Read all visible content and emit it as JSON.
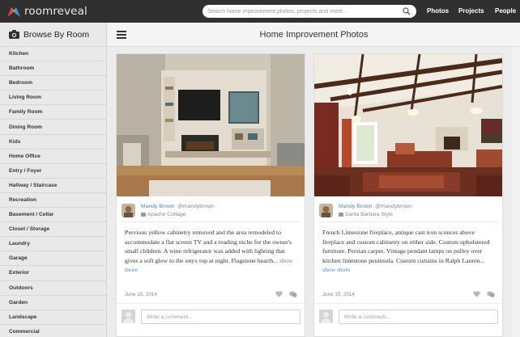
{
  "brand": {
    "name": "roomreveal"
  },
  "search": {
    "placeholder": "Search home improvement photos, projects and more..."
  },
  "nav": [
    "Photos",
    "Projects",
    "People"
  ],
  "sidebar": {
    "title": "Browse By Room",
    "items": [
      "Kitchen",
      "Bathroom",
      "Bedroom",
      "Living Room",
      "Family Room",
      "Dining Room",
      "Kids",
      "Home Office",
      "Entry / Foyer",
      "Hallway / Staircase",
      "Recreation",
      "Basement / Cellar",
      "Closet / Storage",
      "Laundry",
      "Garage",
      "Exterior",
      "Outdoors",
      "Garden",
      "Landscape",
      "Commercial"
    ]
  },
  "main": {
    "title": "Home Improvement Photos"
  },
  "cards": [
    {
      "author": "Mandy Brown",
      "handle": "@mandybrown",
      "style": "Apache Cottage",
      "description": "Previous yellow cabinetry removed and the area remodeled to accommodate a flat screen TV and a reading niche for the owner's small children. A wine refrigerator was added with lighting that gives a soft glow to the onyx top at night. Flagstone hearth...",
      "more_label": "show more",
      "date": "June 15, 2014",
      "comment_placeholder": "Write a comment..."
    },
    {
      "author": "Mandy Brown",
      "handle": "@mandybrown",
      "style": "Santa Barbara Style",
      "description": "French Limestone fireplace, antique cast iron sconces above fireplace and custom cabinetry on either side. Custom upholstered furniture. Persian carpet. Vintage pendant lamps on pulley over kitchen limestone peninsula. Custom curtains in Ralph Lauren...",
      "more_label": "show more",
      "date": "June 15, 2014",
      "comment_placeholder": "Write a comment..."
    }
  ],
  "colors": {
    "topbar": "#303030",
    "link": "#4a86c5",
    "brand_icon_left": "#e0454f",
    "brand_icon_right": "#4a8fd6"
  }
}
